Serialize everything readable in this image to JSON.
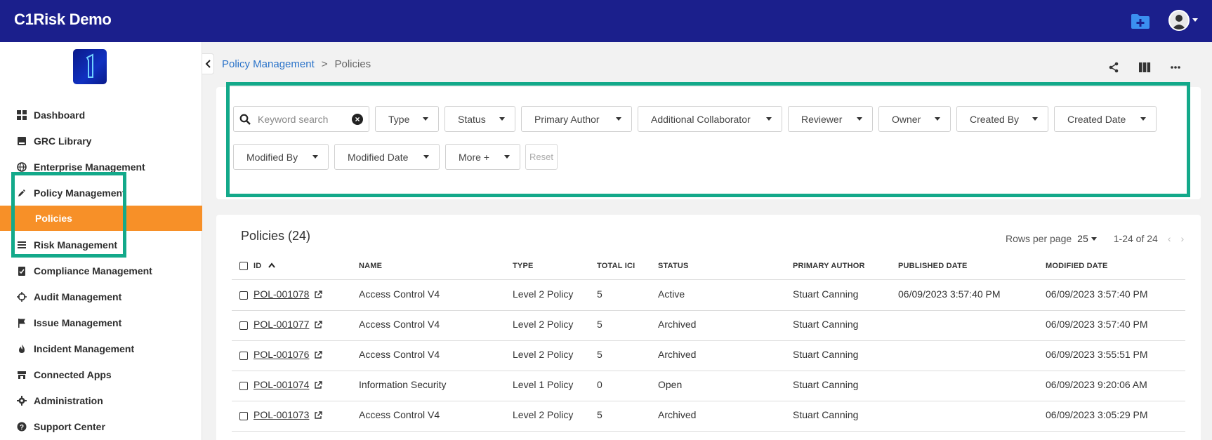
{
  "app": {
    "title": "C1Risk Demo"
  },
  "header": {
    "folder_icon": "folder-plus-icon",
    "avatar_icon": "user-avatar-icon"
  },
  "colors": {
    "topbar": "#1b1f8c",
    "active_nav": "#f79028",
    "highlight": "#13a98a",
    "link": "#2a73c9"
  },
  "sidebar": {
    "items": [
      {
        "label": "Dashboard",
        "icon": "grid-icon"
      },
      {
        "label": "GRC Library",
        "icon": "book-icon"
      },
      {
        "label": "Enterprise Management",
        "icon": "globe-icon"
      },
      {
        "label": "Policy Management",
        "icon": "pencil-icon"
      },
      {
        "label": "Policies",
        "icon": ""
      },
      {
        "label": "Risk Management",
        "icon": "list-icon"
      },
      {
        "label": "Compliance Management",
        "icon": "clipboard-check-icon"
      },
      {
        "label": "Audit Management",
        "icon": "crosshair-icon"
      },
      {
        "label": "Issue Management",
        "icon": "flag-icon"
      },
      {
        "label": "Incident Management",
        "icon": "flame-icon"
      },
      {
        "label": "Connected Apps",
        "icon": "store-icon"
      },
      {
        "label": "Administration",
        "icon": "gear-icon"
      },
      {
        "label": "Support Center",
        "icon": "question-circle-icon"
      }
    ]
  },
  "breadcrumb": {
    "parent": "Policy Management",
    "separator": ">",
    "current": "Policies"
  },
  "filters": {
    "search_placeholder": "Keyword search",
    "buttons": [
      "Type",
      "Status",
      "Primary Author",
      "Additional Collaborator",
      "Reviewer",
      "Owner",
      "Created By",
      "Created Date",
      "Modified By",
      "Modified Date",
      "More +"
    ],
    "reset": "Reset"
  },
  "table": {
    "title": "Policies (24)",
    "rows_per_page_label": "Rows per page",
    "rows_per_page": "25",
    "range": "1-24 of 24",
    "columns": [
      "ID",
      "NAME",
      "TYPE",
      "TOTAL ICI",
      "STATUS",
      "PRIMARY AUTHOR",
      "PUBLISHED DATE",
      "MODIFIED DATE"
    ],
    "rows": [
      {
        "id": "POL-001078",
        "name": "Access Control V4",
        "type": "Level 2 Policy",
        "ici": "5",
        "status": "Active",
        "author": "Stuart Canning",
        "published": "06/09/2023 3:57:40 PM",
        "modified": "06/09/2023 3:57:40 PM"
      },
      {
        "id": "POL-001077",
        "name": "Access Control V4",
        "type": "Level 2 Policy",
        "ici": "5",
        "status": "Archived",
        "author": "Stuart Canning",
        "published": "",
        "modified": "06/09/2023 3:57:40 PM"
      },
      {
        "id": "POL-001076",
        "name": "Access Control V4",
        "type": "Level 2 Policy",
        "ici": "5",
        "status": "Archived",
        "author": "Stuart Canning",
        "published": "",
        "modified": "06/09/2023 3:55:51 PM"
      },
      {
        "id": "POL-001074",
        "name": "Information Security",
        "type": "Level 1 Policy",
        "ici": "0",
        "status": "Open",
        "author": "Stuart Canning",
        "published": "",
        "modified": "06/09/2023 9:20:06 AM"
      },
      {
        "id": "POL-001073",
        "name": "Access Control V4",
        "type": "Level 2 Policy",
        "ici": "5",
        "status": "Archived",
        "author": "Stuart Canning",
        "published": "",
        "modified": "06/09/2023 3:05:29 PM"
      }
    ]
  }
}
